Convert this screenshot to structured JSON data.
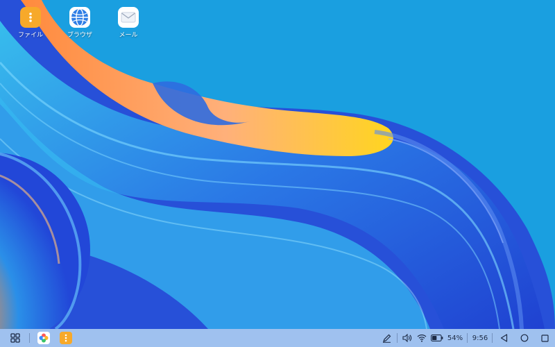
{
  "desktop": {
    "icons": [
      {
        "label": "ファイル",
        "icon": "files-icon",
        "color": "#f7a92a"
      },
      {
        "label": "ブラウザ",
        "icon": "browser-icon",
        "color": "#2f7ee6"
      },
      {
        "label": "メール",
        "icon": "mail-icon",
        "color": "#ffffff"
      }
    ]
  },
  "taskbar": {
    "start_icon": "app-grid-icon",
    "pinned": [
      {
        "icon": "gallery-icon"
      },
      {
        "icon": "files-icon",
        "color": "#f7a92a"
      }
    ],
    "tray": {
      "pen_icon": "pen-icon",
      "volume_icon": "volume-icon",
      "wifi_icon": "wifi-icon",
      "battery_percent": "54%",
      "battery_level": 0.54,
      "time": "9:56"
    },
    "nav": [
      "back-icon",
      "home-icon",
      "recents-icon"
    ]
  },
  "colors": {
    "desktop_background": "#1a9fe0",
    "taskbar": "#aac3f0"
  }
}
